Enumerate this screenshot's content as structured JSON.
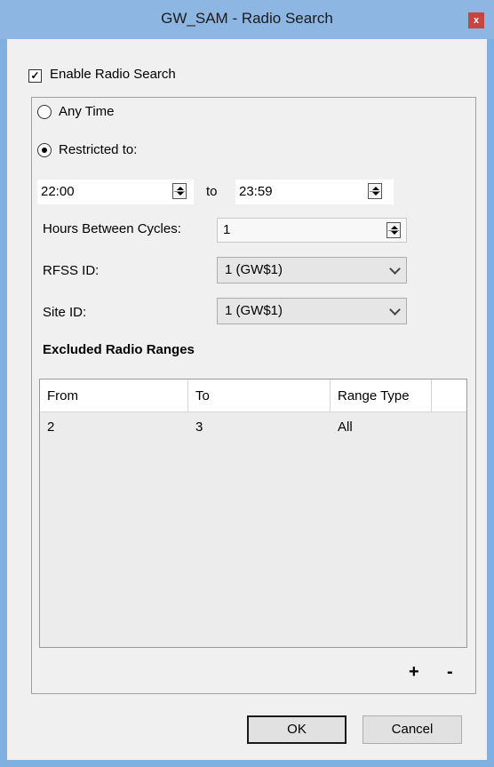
{
  "window": {
    "title": "GW_SAM - Radio Search",
    "close_glyph": "x"
  },
  "enable": {
    "label": "Enable Radio Search",
    "checked": true,
    "check_glyph": "✓"
  },
  "schedule": {
    "any_time_label": "Any Time",
    "restricted_label": "Restricted to:",
    "selected": "restricted",
    "start_time": "22:00",
    "to_label": "to",
    "end_time": "23:59"
  },
  "hours": {
    "label": "Hours Between Cycles:",
    "value": "1"
  },
  "rfss": {
    "label": "RFSS ID:",
    "value": "1 (GW$1)"
  },
  "site": {
    "label": "Site ID:",
    "value": "1 (GW$1)"
  },
  "excluded": {
    "heading": "Excluded Radio Ranges",
    "columns": [
      "From",
      "To",
      "Range Type"
    ],
    "rows": [
      [
        "2",
        "3",
        "All"
      ]
    ],
    "add_label": "+",
    "remove_label": "-"
  },
  "buttons": {
    "ok": "OK",
    "cancel": "Cancel"
  },
  "colors": {
    "titlebar": "#8db6e2",
    "close": "#c7443f",
    "client": "#f0f0f0"
  }
}
